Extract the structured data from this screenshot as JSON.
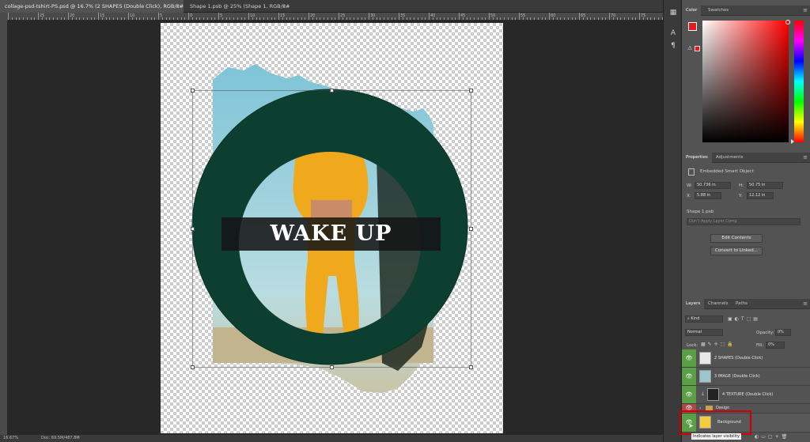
{
  "tabs": [
    {
      "label": "collage-psd-tshirt-PS.psd @ 16.7% (2 SHAPES (Double Click), RGB/8#) *",
      "close": "×"
    },
    {
      "label": "Shape 1.psb @ 25% (Shape 1, RGB/8#)",
      "close": "×"
    }
  ],
  "ruler": {
    "ticks": [
      "",
      "25",
      "20",
      "15",
      "10",
      "5",
      "0",
      "5",
      "10",
      "15",
      "20",
      "25",
      "30",
      "35",
      "40",
      "45",
      "50",
      "55",
      "60",
      "65",
      "70",
      "75",
      "80"
    ]
  },
  "canvas": {
    "text": "WAKE UP"
  },
  "status": {
    "zoom": "16.67%",
    "doc": "Doc: 69.5M/487.8M"
  },
  "colors": {
    "foreground": "#e5191c",
    "background": "#d9f3f5",
    "ring": "#0c3f30",
    "layers_green": "#5a9e46",
    "highlight_box": "#cc0000"
  },
  "color_panel": {
    "tabs": [
      "Color",
      "Swatches"
    ]
  },
  "properties": {
    "tabs": [
      "Properties",
      "Adjustments"
    ],
    "type": "Embedded Smart Object",
    "w_label": "W:",
    "w": "50.736 in",
    "h_label": "H:",
    "h": "50.75 in",
    "x_label": "X:",
    "x": "5.88 in",
    "y_label": "Y:",
    "y": "12.12 in",
    "source": "Shape 1.psb",
    "layer_comp": "Don't Apply Layer Comp",
    "edit_btn": "Edit Contents",
    "convert_btn": "Convert to Linked..."
  },
  "layers_panel": {
    "tabs": [
      "Layers",
      "Channels",
      "Paths"
    ],
    "filter": "Kind",
    "blend": "Normal",
    "opacity_label": "Opacity:",
    "opacity": "0%",
    "lock_label": "Lock:",
    "fill_label": "Fill:",
    "fill": "0%",
    "layers": [
      {
        "name": "2 SHAPES (Double Click)",
        "eye": "👁"
      },
      {
        "name": "3 IMAGE (Double Click)",
        "eye": "👁"
      },
      {
        "name": "4 TEXTURE (Double Click)",
        "eye": "👁"
      },
      {
        "name": "Design",
        "eye": "👁"
      },
      {
        "name": "Background",
        "eye": "👁"
      }
    ],
    "tooltip": "Indicates layer visibility"
  }
}
